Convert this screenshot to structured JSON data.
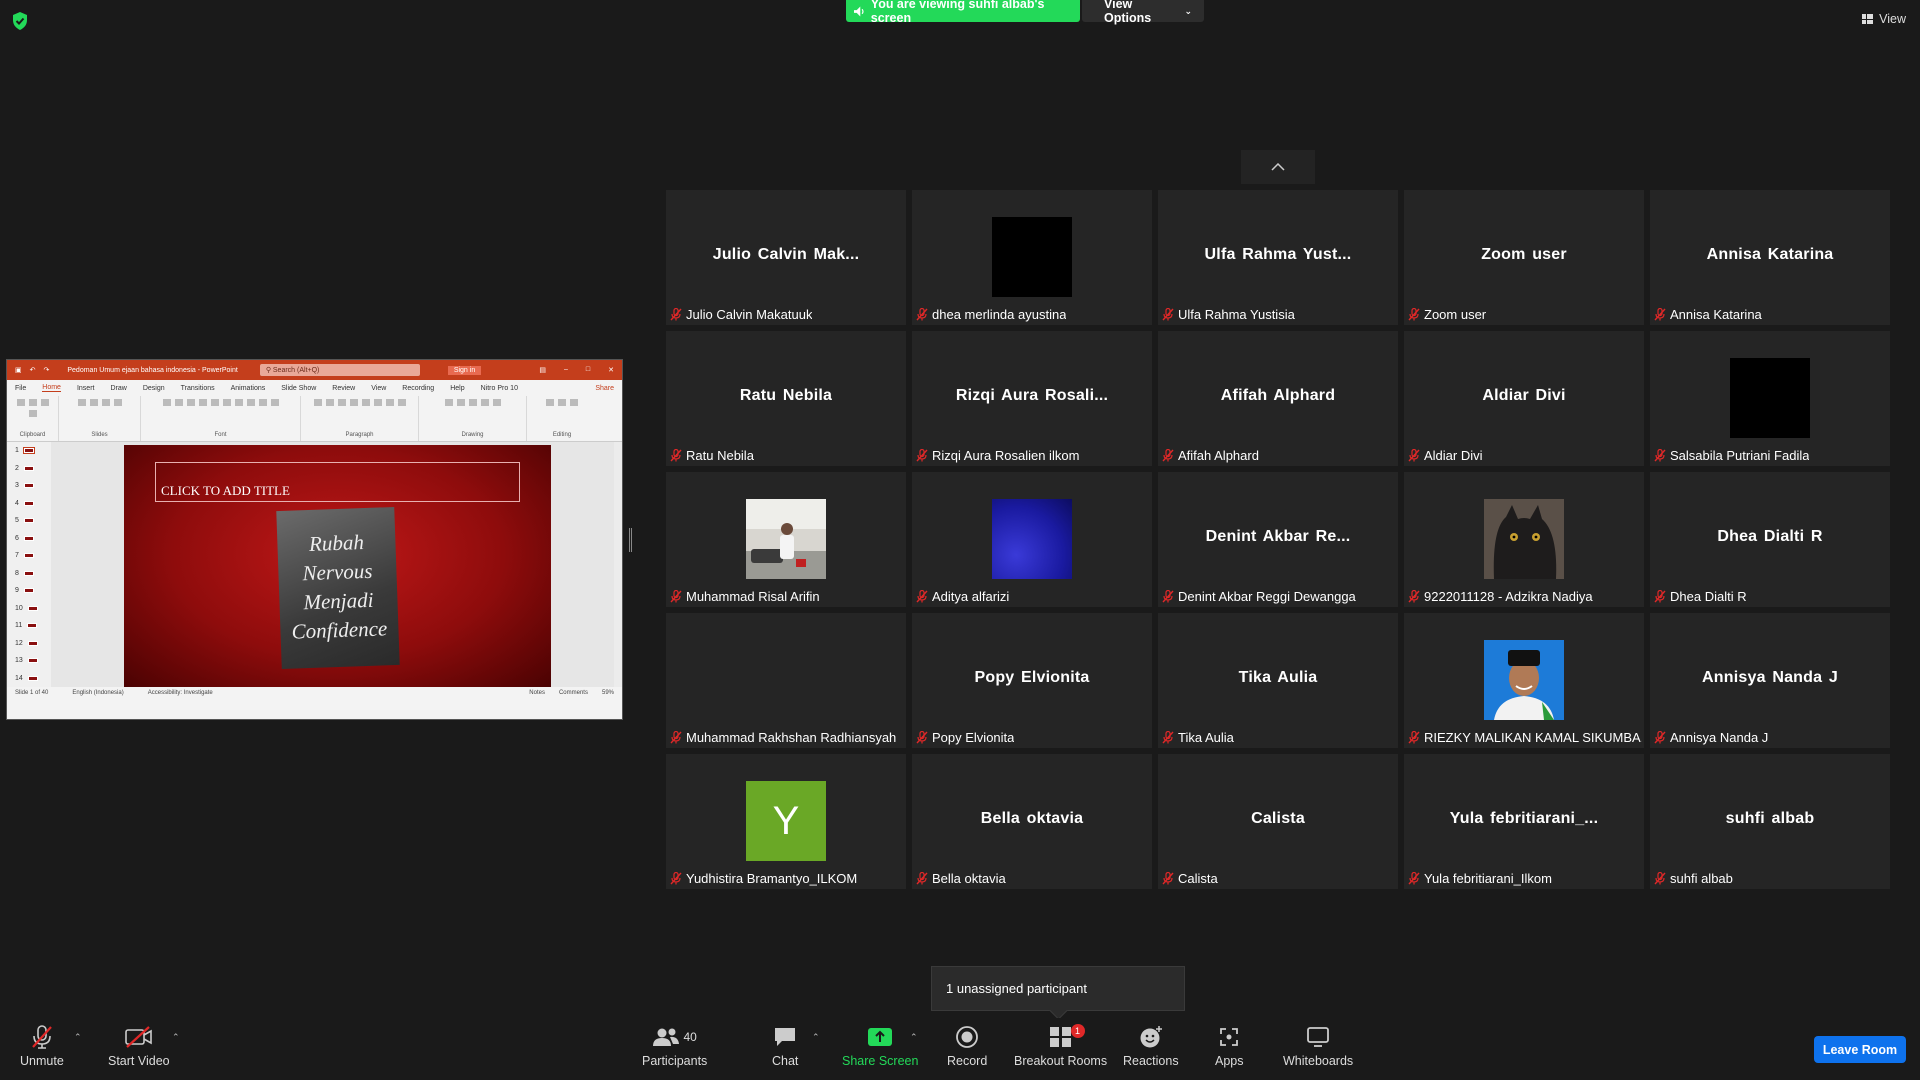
{
  "banner": {
    "viewing_text": "You are viewing suhfi albab's screen",
    "view_options": "View Options"
  },
  "view_button": "View",
  "powerpoint": {
    "doc_title": "Pedoman Umum ejaan bahasa indonesia - PowerPoint",
    "search_placeholder": "Search (Alt+Q)",
    "sign_in": "Sign in",
    "menu": [
      "File",
      "Home",
      "Insert",
      "Draw",
      "Design",
      "Transitions",
      "Animations",
      "Slide Show",
      "Review",
      "View",
      "Recording",
      "Help",
      "Nitro Pro 10"
    ],
    "share": "Share",
    "ribbon_groups": [
      "Clipboard",
      "Slides",
      "Font",
      "Paragraph",
      "Drawing",
      "Editing"
    ],
    "slide_numbers": [
      "1",
      "2",
      "3",
      "4",
      "5",
      "6",
      "7",
      "8",
      "9",
      "10",
      "11",
      "12",
      "13",
      "14"
    ],
    "slide_title": "CLICK TO ADD TITLE",
    "sign_lines": [
      "Rubah",
      "Nervous",
      "Menjadi",
      "Confidence"
    ],
    "status_left": "Slide 1 of 40",
    "status_lang": "English (Indonesia)",
    "status_access": "Accessibility: Investigate",
    "status_notes": "Notes",
    "status_comments": "Comments",
    "zoom": "59%"
  },
  "participants": [
    {
      "big": "Julio  Calvin  Mak...",
      "name": "Julio Calvin Makatuuk",
      "video": null
    },
    {
      "big": "",
      "name": "dhea merlinda ayustina",
      "video": "black"
    },
    {
      "big": "Ulfa  Rahma  Yust...",
      "name": "Ulfa Rahma Yustisia",
      "video": null
    },
    {
      "big": "Zoom user",
      "name": "Zoom user",
      "video": null
    },
    {
      "big": "Annisa Katarina",
      "name": "Annisa Katarina",
      "video": null
    },
    {
      "big": "Ratu Nebila",
      "name": "Ratu Nebila",
      "video": null
    },
    {
      "big": "Rizqi  Aura  Rosali...",
      "name": "Rizqi Aura Rosalien ilkom",
      "video": null
    },
    {
      "big": "Afifah Alphard",
      "name": "Afifah Alphard",
      "video": null
    },
    {
      "big": "Aldiar Divi",
      "name": "Aldiar Divi",
      "video": null
    },
    {
      "big": "",
      "name": "Salsabila Putriani Fadila",
      "video": "black"
    },
    {
      "big": "",
      "name": "Muhammad Risal Arifin",
      "video": "photo-person"
    },
    {
      "big": "",
      "name": "Aditya alfarizi",
      "video": "blue"
    },
    {
      "big": "Denint  Akbar  Re...",
      "name": "Denint Akbar Reggi Dewangga",
      "video": null
    },
    {
      "big": "",
      "name": "9222011128 - Adzikra Nadiya",
      "video": "photo-cat"
    },
    {
      "big": "Dhea Dialti R",
      "name": "Dhea Dialti R",
      "video": null
    },
    {
      "big": "",
      "name": "Muhammad Rakhshan Radhiansyah",
      "video": "none"
    },
    {
      "big": "Popy Elvionita",
      "name": "Popy Elvionita",
      "video": null
    },
    {
      "big": "Tika Aulia",
      "name": "Tika Aulia",
      "video": null
    },
    {
      "big": "",
      "name": "RIEZKY MALIKAN KAMAL SIKUMBA...",
      "video": "photo-portrait"
    },
    {
      "big": "Annisya Nanda J",
      "name": "Annisya Nanda J",
      "video": null
    },
    {
      "big": "",
      "name": "Yudhistira Bramantyo_ILKOM",
      "video": "letter-Y"
    },
    {
      "big": "Bella oktavia",
      "name": "Bella oktavia",
      "video": null
    },
    {
      "big": "Calista",
      "name": "Calista",
      "video": null
    },
    {
      "big": "Yula  febritiarani_...",
      "name": "Yula febritiarani_Ilkom",
      "video": null
    },
    {
      "big": "suhfi albab",
      "name": "suhfi albab",
      "video": null
    }
  ],
  "avatar_letter": "Y",
  "tooltip": "1 unassigned participant",
  "toolbar": {
    "unmute": "Unmute",
    "start_video": "Start Video",
    "participants": "Participants",
    "participants_count": "40",
    "chat": "Chat",
    "share_screen": "Share Screen",
    "record": "Record",
    "breakout_rooms": "Breakout Rooms",
    "breakout_badge": "1",
    "reactions": "Reactions",
    "apps": "Apps",
    "whiteboards": "Whiteboards",
    "leave_room": "Leave Room"
  },
  "colors": {
    "accent_green": "#23d959",
    "leave_blue": "#0e72ed",
    "mute_red": "#e02828",
    "ppt_red": "#c43e1c",
    "avatar_green": "#6aa826"
  }
}
